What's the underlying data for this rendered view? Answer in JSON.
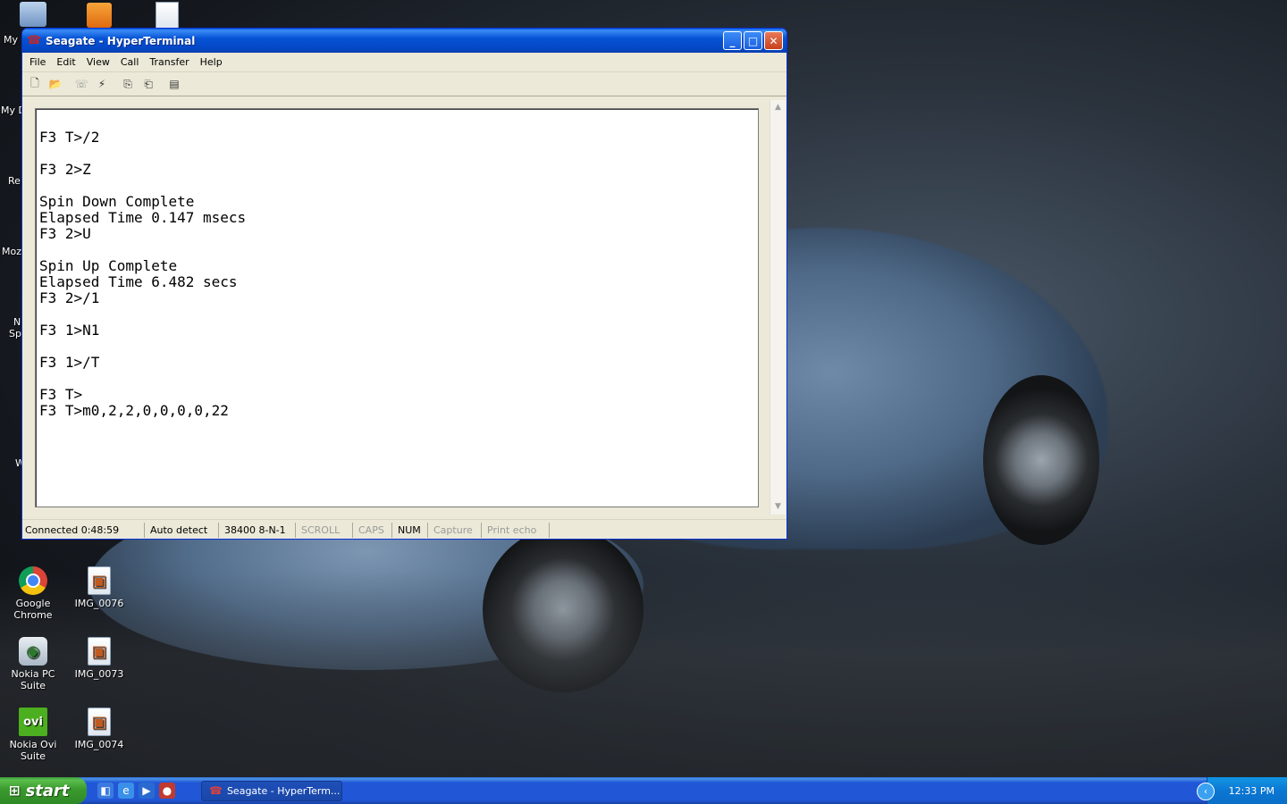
{
  "window": {
    "title": "Seagate - HyperTerminal",
    "minimize": "_",
    "maximize": "□",
    "close": "✕"
  },
  "menu": [
    "File",
    "Edit",
    "View",
    "Call",
    "Transfer",
    "Help"
  ],
  "toolbar_icons": [
    "new-icon",
    "open-icon",
    "connect-icon",
    "disconnect-icon",
    "send-icon",
    "receive-icon",
    "properties-icon"
  ],
  "terminal": {
    "lines": [
      "F3 T>/2",
      "",
      "F3 2>Z",
      "",
      "Spin Down Complete",
      "Elapsed Time 0.147 msecs",
      "F3 2>U",
      "",
      "Spin Up Complete",
      "Elapsed Time 6.482 secs",
      "F3 2>/1",
      "",
      "F3 1>N1",
      "",
      "F3 1>/T",
      "",
      "F3 T>",
      "F3 T>m0,2,2,0,0,0,0,22"
    ]
  },
  "status": {
    "connected": "Connected 0:48:59",
    "detect": "Auto detect",
    "settings": "38400 8-N-1",
    "scroll": "SCROLL",
    "caps": "CAPS",
    "num": "NUM",
    "capture": "Capture",
    "print_echo": "Print echo"
  },
  "desktop": {
    "edge_labels": [
      "My",
      "My D",
      "Re",
      "Moz",
      "N",
      "Sp",
      "W"
    ],
    "icons": [
      {
        "label": "Google Chrome",
        "icon": "chrome-icon"
      },
      {
        "label": "IMG_0076",
        "icon": "image-file-icon"
      },
      {
        "label": "Nokia PC Suite",
        "icon": "nokia-pc-suite-icon"
      },
      {
        "label": "IMG_0073",
        "icon": "image-file-icon"
      },
      {
        "label": "Nokia Ovi Suite",
        "icon": "ovi-icon"
      },
      {
        "label": "IMG_0074",
        "icon": "image-file-icon"
      }
    ],
    "ovi_text": "ovi"
  },
  "taskbar": {
    "start": "start",
    "task": "Seagate - HyperTerm...",
    "clock": "12:33 PM"
  }
}
